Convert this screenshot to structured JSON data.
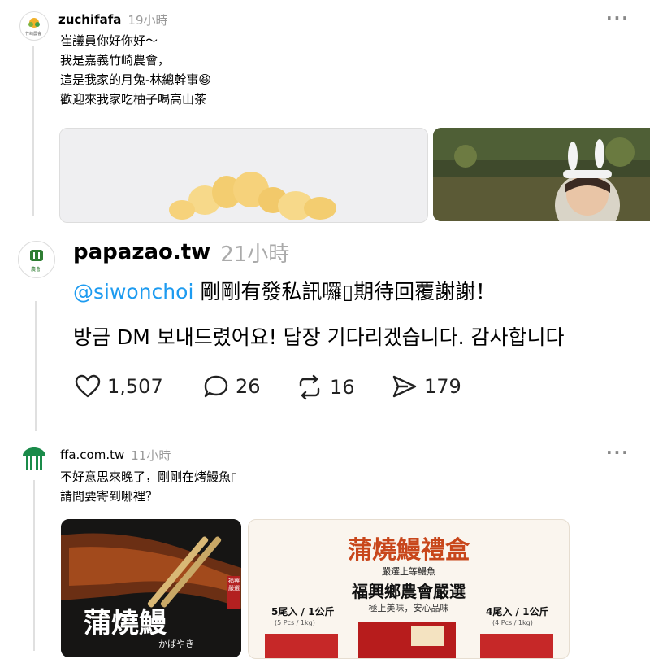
{
  "post1": {
    "username": "zuchifafa",
    "time": "19小時",
    "more": "···",
    "lines": [
      "崔議員你好你好～",
      "我是嘉義竹崎農會，",
      "這是我家的月兔-林總幹事😆",
      "歡迎來我家吃柚子喝高山茶"
    ],
    "avatar_text": "竹崎農會"
  },
  "post2": {
    "username": "papazao.tw",
    "time": "21小時",
    "mention": "@siwonchoi",
    "line1_rest": " 剛剛有發私訊囉▯期待回覆謝謝！",
    "line2": "방금 DM 보내드렸어요! 답장 기다리겠습니다. 감사합니다",
    "likes": "1,507",
    "comments": "26",
    "reposts": "16",
    "shares": "179",
    "avatar_text": "農會"
  },
  "post3": {
    "username": "ffa.com.tw",
    "time": "11小時",
    "more": "···",
    "lines": [
      "不好意思來晚了，剛剛在烤鰻魚▯",
      "請問要寄到哪裡？"
    ],
    "img1": {
      "title": "蒲燒鰻",
      "sub": "かばやき",
      "tag": "福興嚴選"
    },
    "img2": {
      "title": "蒲燒鰻禮盒",
      "sub1": "嚴選上等鰻魚",
      "sub2": "福興鄉農會嚴選",
      "sub3": "極上美味，安心品味",
      "left_label": "5尾入 / 1公斤",
      "left_sub": "(5 Pcs / 1kg)",
      "right_label": "4尾入 / 1公斤",
      "right_sub": "(4 Pcs / 1kg)"
    }
  },
  "colors": {
    "mention": "#1d9bf0",
    "eel_title": "#c8461b"
  }
}
